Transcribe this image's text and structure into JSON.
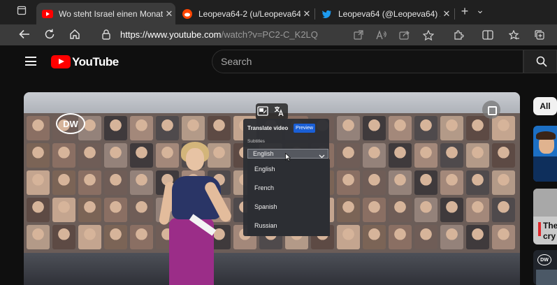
{
  "browser": {
    "tabs": [
      {
        "title": "Wo steht Israel einen Monat nach",
        "favicon": "youtube-icon",
        "active": true
      },
      {
        "title": "Leopeva64-2 (u/Leopeva64-2) - r",
        "favicon": "reddit-icon",
        "active": false
      },
      {
        "title": "Leopeva64 (@Leopeva64) / Twitt",
        "favicon": "twitter-icon",
        "active": false
      }
    ],
    "close_glyph": "✕",
    "new_tab_glyph": "+",
    "tab_list_glyph": "⌄",
    "url_host": "https://www.youtube.com",
    "url_path": "/watch?v=PC2-C_K2LQ"
  },
  "youtube": {
    "logo_text": "YouTube",
    "search_placeholder": "Search"
  },
  "video": {
    "channel_logo": "DW"
  },
  "translate_popup": {
    "title": "Translate video",
    "badge": "Preview",
    "subtitles_label": "Subtitles",
    "selected_language": "English",
    "options": [
      "English",
      "French",
      "Spanish",
      "Russian"
    ]
  },
  "sidebar": {
    "chip_all": "All",
    "thumb_text_1": "The",
    "thumb_text_2": "cry",
    "thumb_badge": "DW"
  },
  "colors": {
    "youtube_red": "#ff0000",
    "preview_badge": "#1a5fd6",
    "tab_active": "#3b3b3b",
    "tab_strip": "#202020"
  }
}
